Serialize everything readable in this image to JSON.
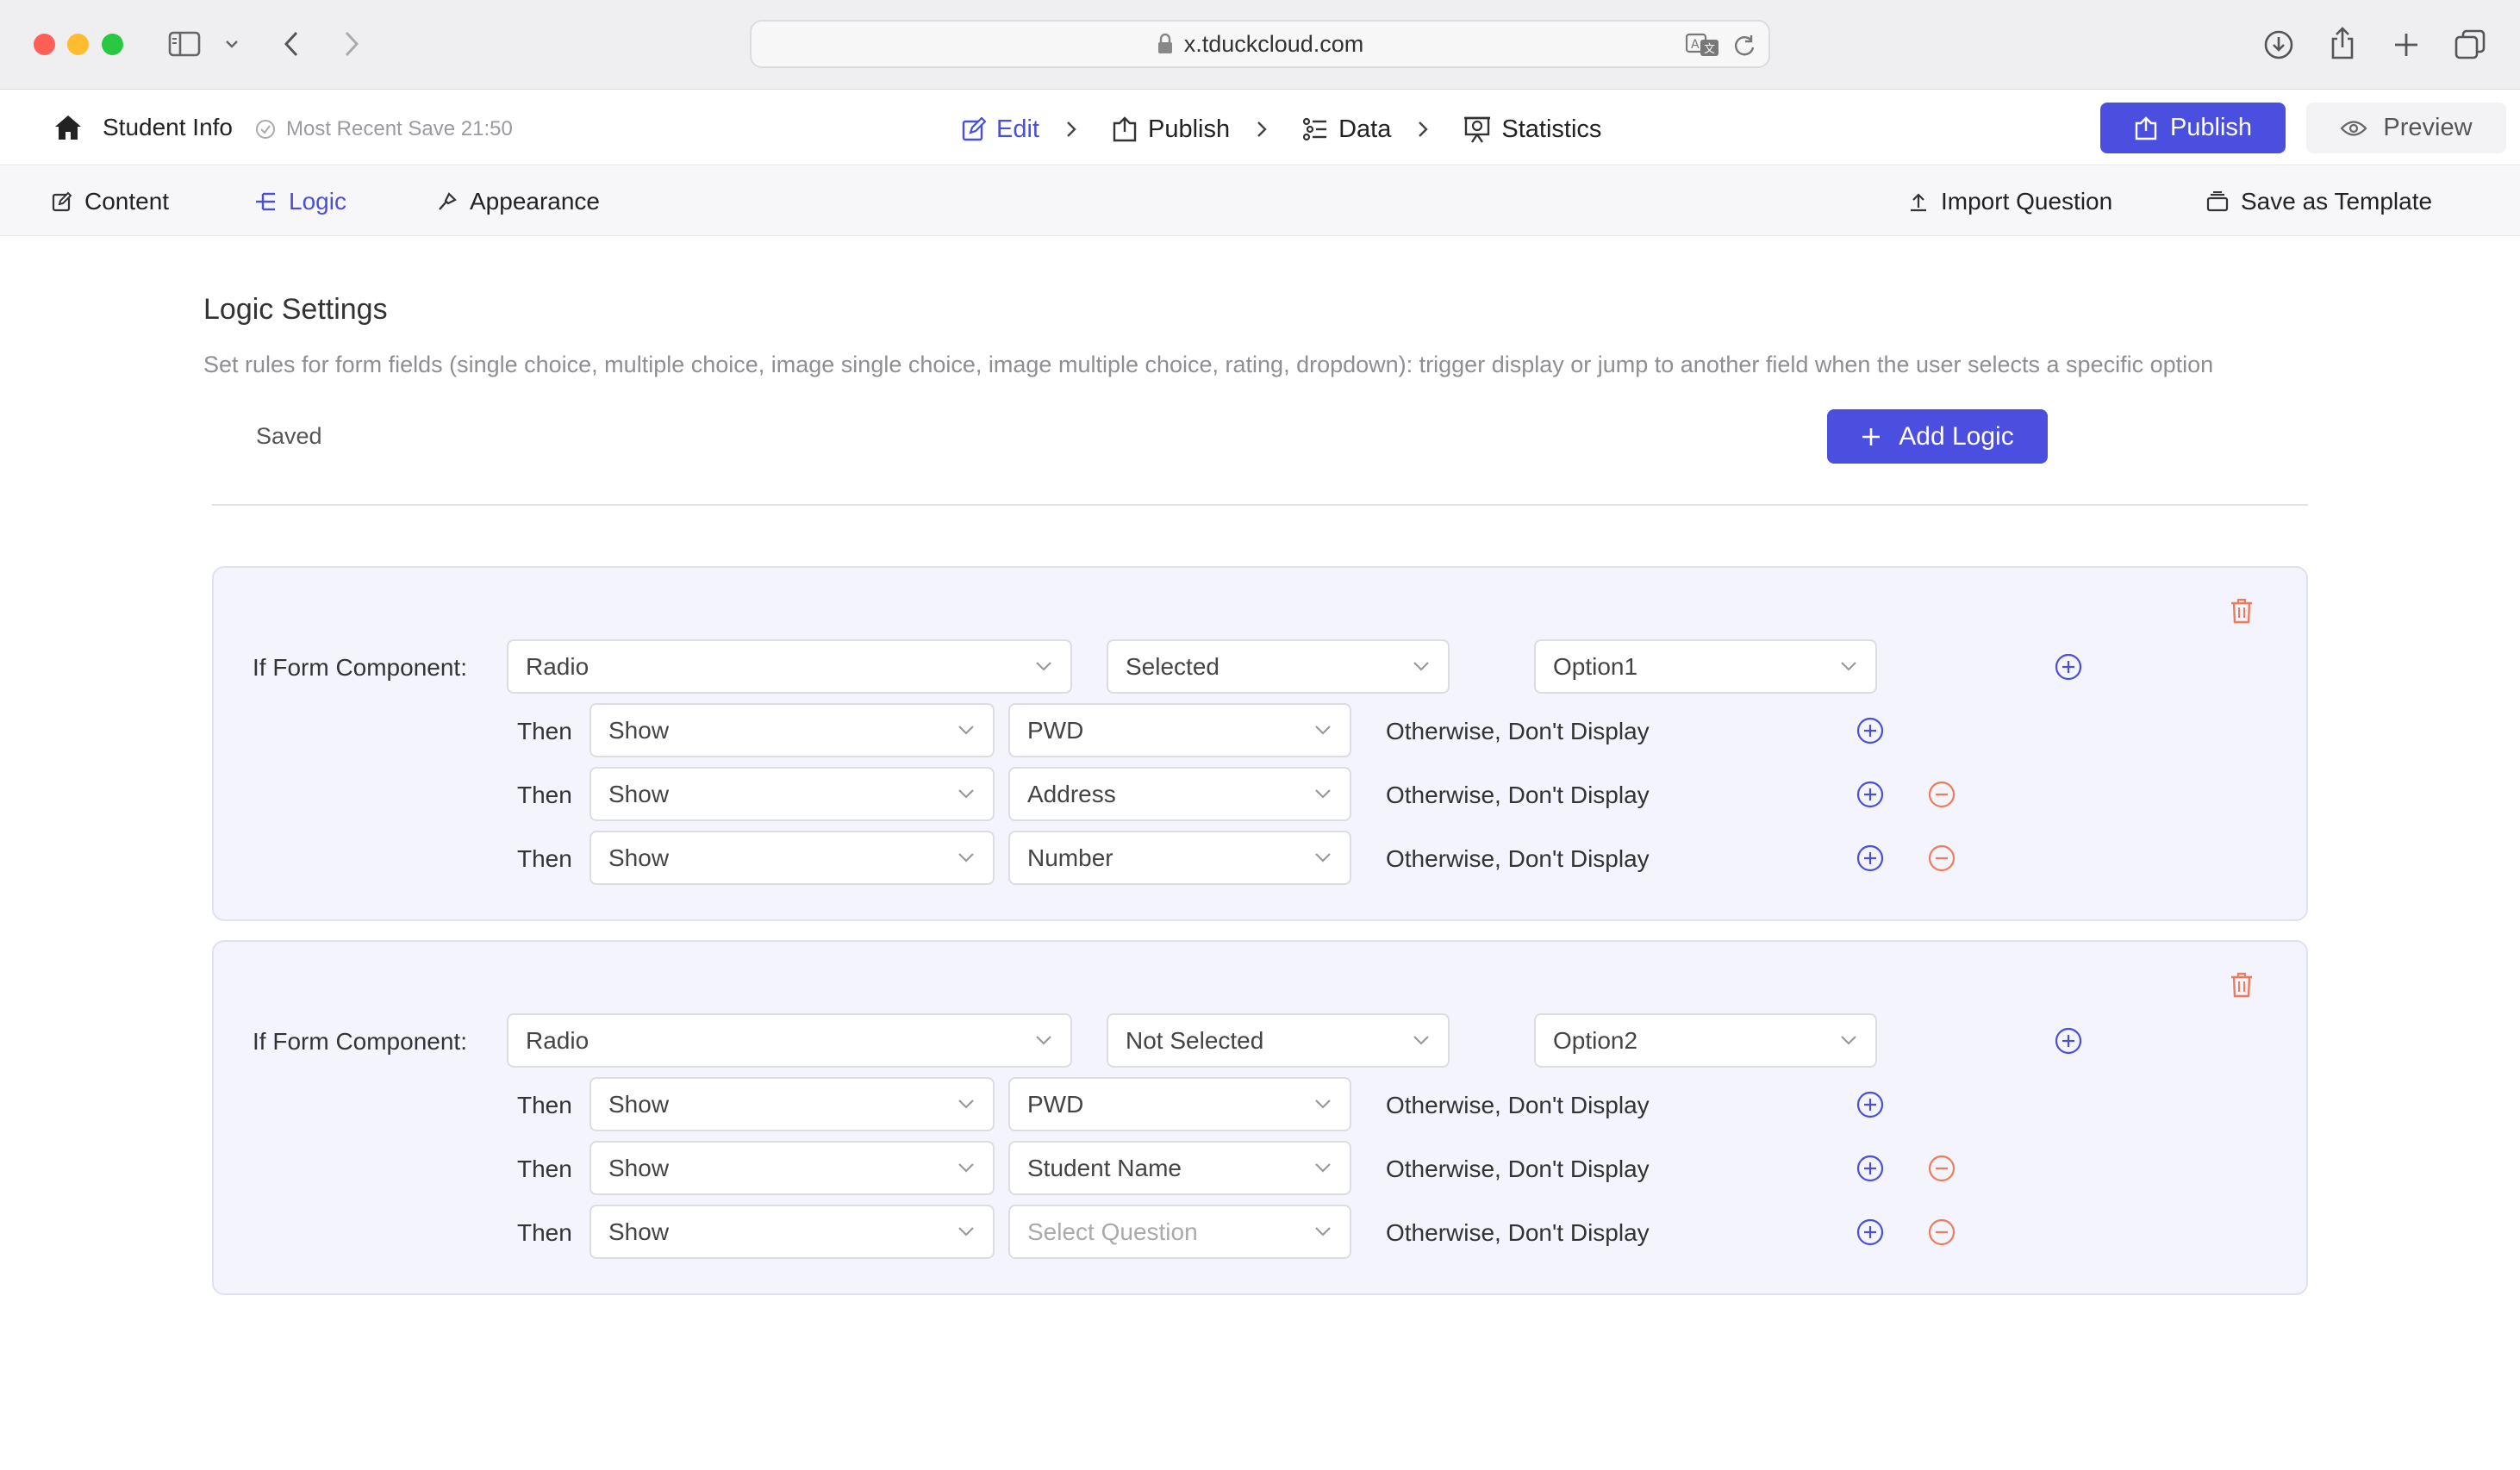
{
  "browser": {
    "url": "x.tduckcloud.com"
  },
  "header": {
    "form_title": "Student Info",
    "save_status": "Most Recent Save 21:50",
    "steps": [
      {
        "label": "Edit",
        "active": true
      },
      {
        "label": "Publish",
        "active": false
      },
      {
        "label": "Data",
        "active": false
      },
      {
        "label": "Statistics",
        "active": false
      }
    ],
    "publish_button": "Publish",
    "preview_button": "Preview",
    "accent_color": "#4b4fe0"
  },
  "subtabs": {
    "content": "Content",
    "logic": "Logic",
    "appearance": "Appearance",
    "import_question": "Import Question",
    "save_as_template": "Save as Template",
    "active": "Logic"
  },
  "logic": {
    "title": "Logic Settings",
    "description": "Set rules for form fields (single choice, multiple choice, image single choice, image multiple choice, rating, dropdown): trigger display or jump to another field when the user selects a specific option",
    "saved_status": "Saved",
    "add_button": "Add Logic",
    "if_label": "If Form Component:",
    "then_label": "Then",
    "otherwise_label": "Otherwise, Don't Display",
    "rules": [
      {
        "component": "Radio",
        "condition": "Selected",
        "option": "Option1",
        "actions": [
          {
            "action": "Show",
            "target": "PWD",
            "placeholder": false,
            "removable": false
          },
          {
            "action": "Show",
            "target": "Address",
            "placeholder": false,
            "removable": true
          },
          {
            "action": "Show",
            "target": "Number",
            "placeholder": false,
            "removable": true
          }
        ]
      },
      {
        "component": "Radio",
        "condition": "Not Selected",
        "option": "Option2",
        "actions": [
          {
            "action": "Show",
            "target": "PWD",
            "placeholder": false,
            "removable": false
          },
          {
            "action": "Show",
            "target": "Student Name",
            "placeholder": false,
            "removable": true
          },
          {
            "action": "Show",
            "target": "Select Question",
            "placeholder": true,
            "removable": true
          }
        ]
      }
    ]
  }
}
